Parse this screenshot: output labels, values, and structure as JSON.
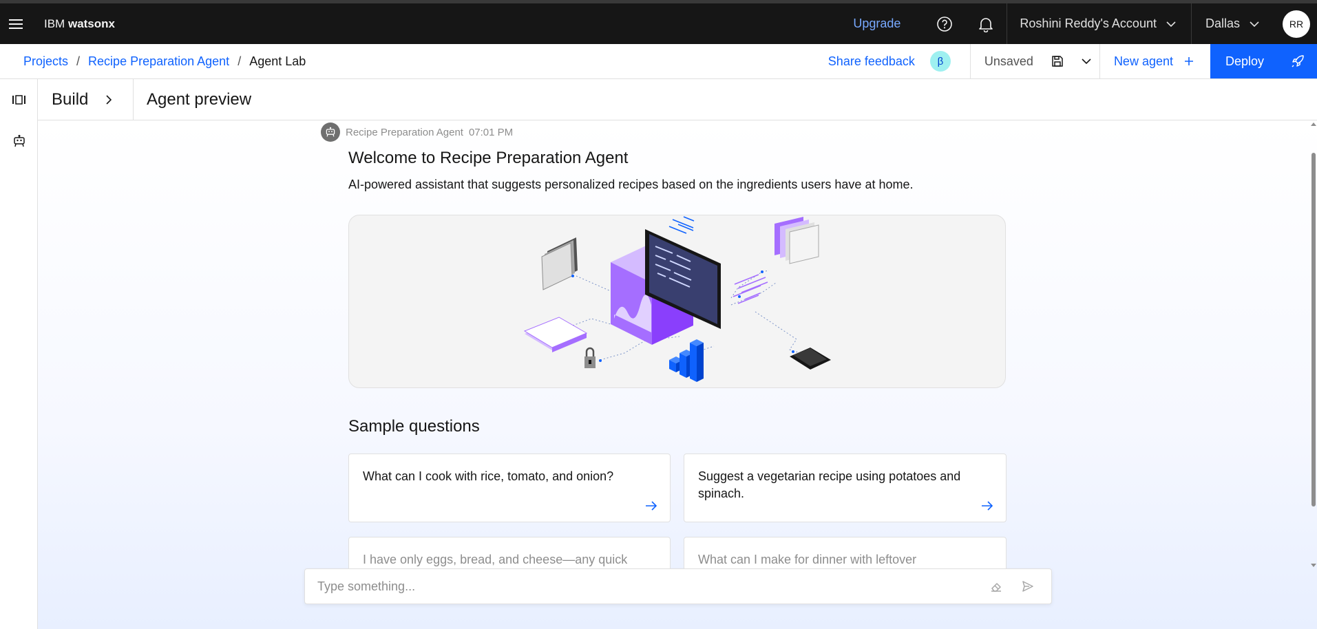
{
  "header": {
    "brand_prefix": "IBM",
    "brand_name": "watsonx",
    "upgrade_label": "Upgrade",
    "account_label": "Roshini Reddy's Account",
    "region_label": "Dallas",
    "avatar_initials": "RR"
  },
  "breadcrumb": {
    "items": [
      "Projects",
      "Recipe Preparation Agent",
      "Agent Lab"
    ],
    "separator": "/"
  },
  "toolbar": {
    "share_feedback_label": "Share feedback",
    "beta_badge": "β",
    "save_status": "Unsaved",
    "new_agent_label": "New agent",
    "deploy_label": "Deploy"
  },
  "subheader": {
    "build_label": "Build",
    "title": "Agent preview"
  },
  "chat": {
    "sender": "Recipe Preparation Agent",
    "time": "07:01 PM",
    "welcome_title": "Welcome to Recipe Preparation Agent",
    "welcome_description": "AI-powered assistant that suggests personalized recipes based on the ingredients users have at home.",
    "sample_title": "Sample questions",
    "sample_questions": [
      "What can I cook with rice, tomato, and onion?",
      "Suggest a vegetarian recipe using potatoes and spinach.",
      "I have only eggs, bread, and cheese—any quick",
      "What can I make for dinner with leftover"
    ],
    "input_placeholder": "Type something..."
  },
  "colors": {
    "brand_blue": "#0f62fe",
    "header_bg": "#161616",
    "link_blue_dark": "#78a9ff",
    "accent_purple": "#8a3ffc"
  }
}
